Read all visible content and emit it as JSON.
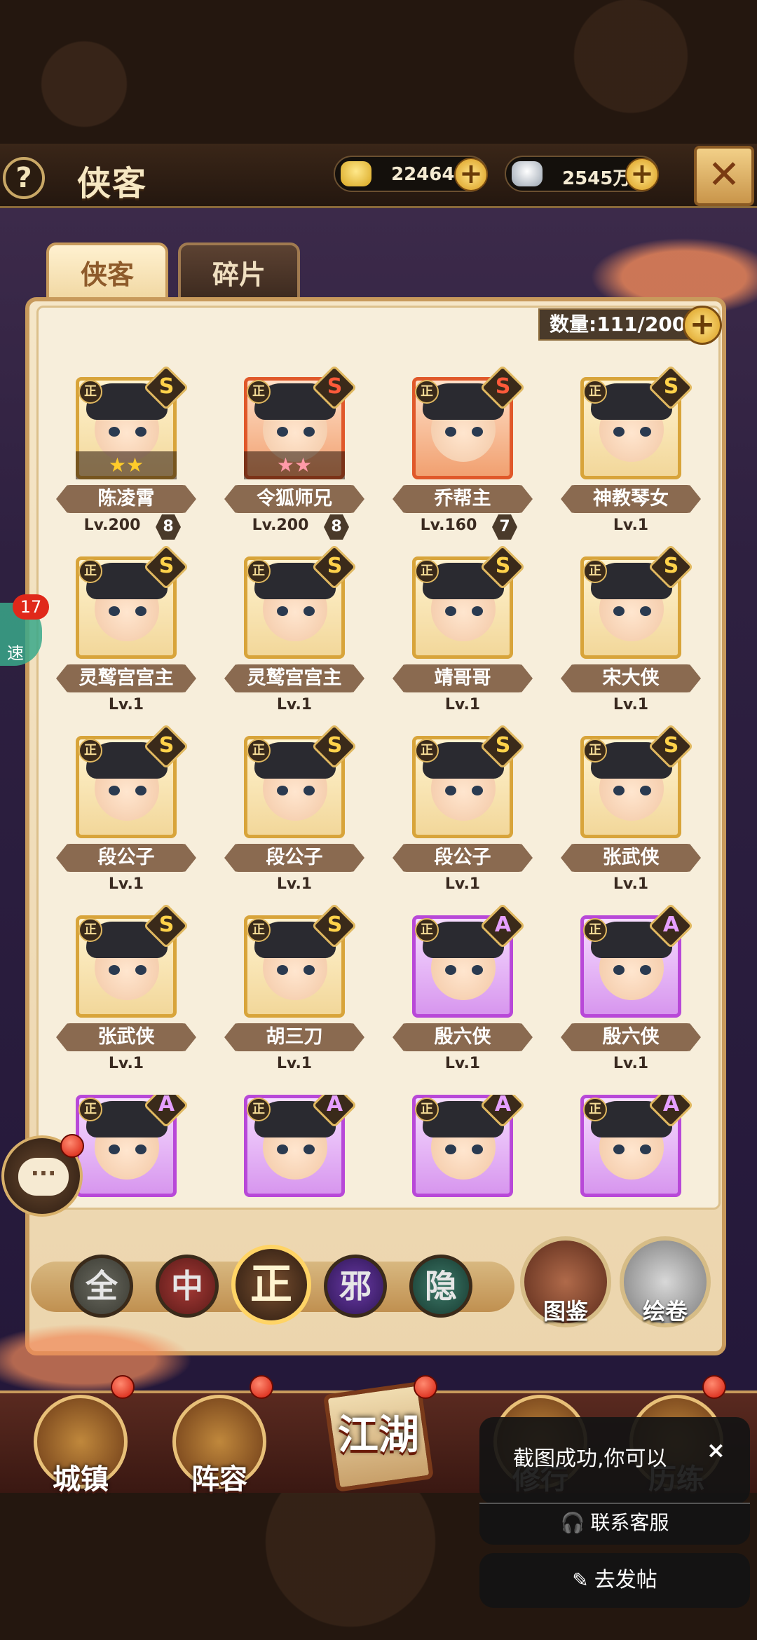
{
  "header": {
    "help_icon": "?",
    "title": "侠客",
    "gold_value": "22464",
    "silver_value": "2545万",
    "plus": "+",
    "close_icon": "✕"
  },
  "tabs": [
    {
      "label": "侠客",
      "active": true
    },
    {
      "label": "碎片",
      "active": false
    }
  ],
  "count_label": "数量:111/200",
  "heroes": [
    {
      "badge": "正",
      "rank": "S",
      "rank_style": "S",
      "name": "陈凌霄",
      "level": "Lv.200",
      "stars_text": "★★",
      "star_color": "gold",
      "awaken": "8"
    },
    {
      "badge": "正",
      "rank": "S",
      "rank_style": "SS",
      "name": "令狐师兄",
      "level": "Lv.200",
      "stars_text": "★★",
      "star_color": "pink",
      "awaken": "8"
    },
    {
      "badge": "正",
      "rank": "S",
      "rank_style": "SS",
      "name": "乔帮主",
      "level": "Lv.160",
      "stars_text": "",
      "star_color": "",
      "awaken": "7"
    },
    {
      "badge": "正",
      "rank": "S",
      "rank_style": "S",
      "name": "神教琴女",
      "level": "Lv.1",
      "stars_text": "",
      "star_color": "",
      "awaken": ""
    },
    {
      "badge": "正",
      "rank": "S",
      "rank_style": "S",
      "name": "灵鹫宫宫主",
      "level": "Lv.1",
      "stars_text": "",
      "star_color": "",
      "awaken": ""
    },
    {
      "badge": "正",
      "rank": "S",
      "rank_style": "S",
      "name": "灵鹫宫宫主",
      "level": "Lv.1",
      "stars_text": "",
      "star_color": "",
      "awaken": ""
    },
    {
      "badge": "正",
      "rank": "S",
      "rank_style": "S",
      "name": "靖哥哥",
      "level": "Lv.1",
      "stars_text": "",
      "star_color": "",
      "awaken": ""
    },
    {
      "badge": "正",
      "rank": "S",
      "rank_style": "S",
      "name": "宋大侠",
      "level": "Lv.1",
      "stars_text": "",
      "star_color": "",
      "awaken": ""
    },
    {
      "badge": "正",
      "rank": "S",
      "rank_style": "S",
      "name": "段公子",
      "level": "Lv.1",
      "stars_text": "",
      "star_color": "",
      "awaken": ""
    },
    {
      "badge": "正",
      "rank": "S",
      "rank_style": "S",
      "name": "段公子",
      "level": "Lv.1",
      "stars_text": "",
      "star_color": "",
      "awaken": ""
    },
    {
      "badge": "正",
      "rank": "S",
      "rank_style": "S",
      "name": "段公子",
      "level": "Lv.1",
      "stars_text": "",
      "star_color": "",
      "awaken": ""
    },
    {
      "badge": "正",
      "rank": "S",
      "rank_style": "S",
      "name": "张武侠",
      "level": "Lv.1",
      "stars_text": "",
      "star_color": "",
      "awaken": ""
    },
    {
      "badge": "正",
      "rank": "S",
      "rank_style": "S",
      "name": "张武侠",
      "level": "Lv.1",
      "stars_text": "",
      "star_color": "",
      "awaken": ""
    },
    {
      "badge": "正",
      "rank": "S",
      "rank_style": "S",
      "name": "胡三刀",
      "level": "Lv.1",
      "stars_text": "",
      "star_color": "",
      "awaken": ""
    },
    {
      "badge": "正",
      "rank": "A",
      "rank_style": "A",
      "name": "殷六侠",
      "level": "Lv.1",
      "stars_text": "",
      "star_color": "",
      "awaken": ""
    },
    {
      "badge": "正",
      "rank": "A",
      "rank_style": "A",
      "name": "殷六侠",
      "level": "Lv.1",
      "stars_text": "",
      "star_color": "",
      "awaken": ""
    },
    {
      "badge": "正",
      "rank": "A",
      "rank_style": "A",
      "name": "",
      "level": "",
      "stars_text": "",
      "star_color": "",
      "awaken": ""
    },
    {
      "badge": "正",
      "rank": "A",
      "rank_style": "A",
      "name": "",
      "level": "",
      "stars_text": "",
      "star_color": "",
      "awaken": ""
    },
    {
      "badge": "正",
      "rank": "A",
      "rank_style": "A",
      "name": "",
      "level": "",
      "stars_text": "",
      "star_color": "",
      "awaken": ""
    },
    {
      "badge": "正",
      "rank": "A",
      "rank_style": "A",
      "name": "",
      "level": "",
      "stars_text": "",
      "star_color": "",
      "awaken": ""
    }
  ],
  "filters": {
    "all": "全",
    "mid": "中",
    "zheng": "正",
    "xie": "邪",
    "yin": "隐"
  },
  "side_buttons": {
    "tujian": "图鉴",
    "huijuan": "绘卷"
  },
  "bottom_nav": {
    "town": "城镇",
    "lineup": "阵容",
    "jianghu": "江湖",
    "cultivate": "修行",
    "train": "历练"
  },
  "float": {
    "badge_count": "17",
    "label": "速",
    "chat_icon": "···"
  },
  "toast": {
    "message": "截图成功,你可以",
    "close": "×",
    "contact": "联系客服",
    "post": "去发帖",
    "headset_icon": "🎧",
    "pen_icon": "✎"
  }
}
